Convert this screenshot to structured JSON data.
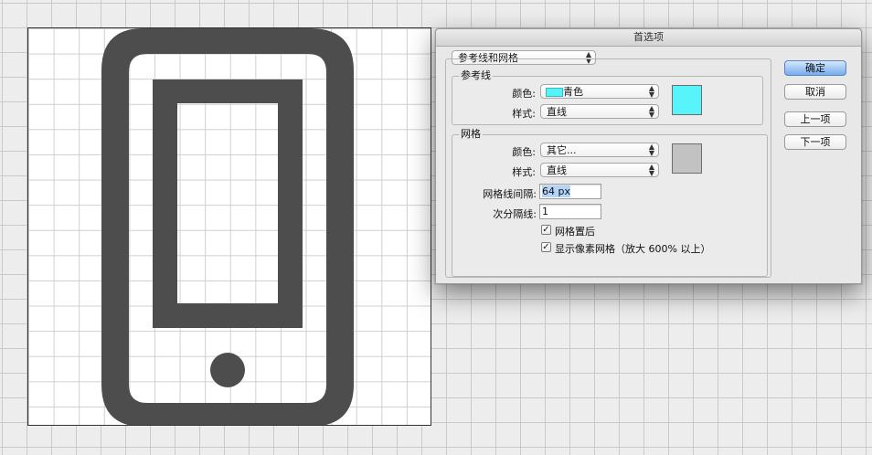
{
  "dialog": {
    "title": "首选项",
    "section_menu": "参考线和网格",
    "guides": {
      "legend": "参考线",
      "color_label": "颜色:",
      "color_value": "青色",
      "color_chip": "#55f2f8",
      "style_label": "样式:",
      "style_value": "直线",
      "swatch_color": "#58f4fb"
    },
    "grid": {
      "legend": "网格",
      "color_label": "颜色:",
      "color_value": "其它...",
      "style_label": "样式:",
      "style_value": "直线",
      "swatch_color": "#c2c2c2",
      "gridline_every_label": "网格线间隔:",
      "gridline_every_value": "64 px",
      "subdivisions_label": "次分隔线:",
      "subdivisions_value": "1",
      "grids_in_back_label": "网格置后",
      "grids_in_back_checked": true,
      "show_pixel_grid_label": "显示像素网格（放大 600% 以上）",
      "show_pixel_grid_checked": true
    },
    "buttons": {
      "ok": "确定",
      "cancel": "取消",
      "prev": "上一项",
      "next": "下一项"
    }
  },
  "canvas": {
    "icon": "phone-icon",
    "icon_color": "#4d4d4d"
  }
}
